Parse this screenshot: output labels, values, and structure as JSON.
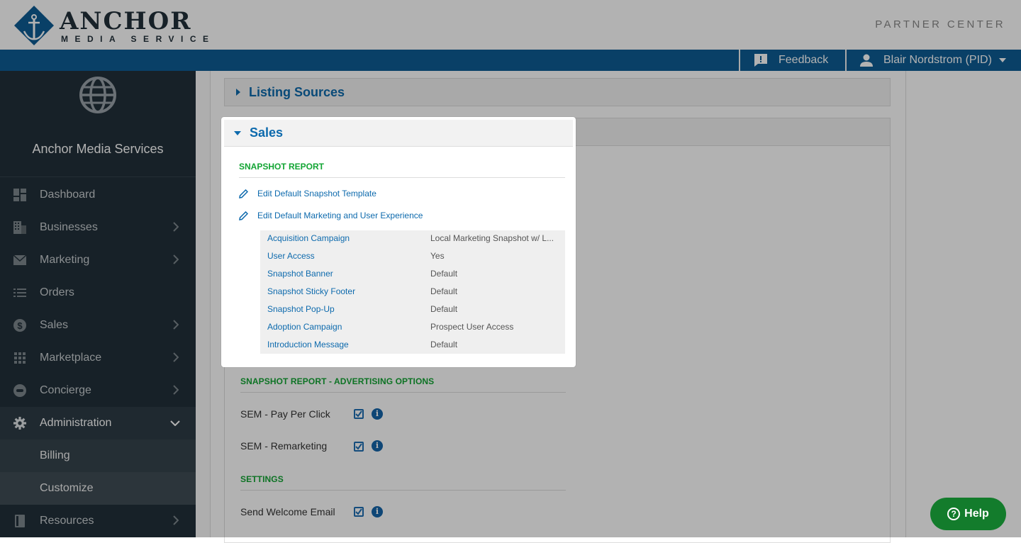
{
  "header": {
    "brand_main": "ANCHOR",
    "brand_sub": "MEDIA SERVICES",
    "partner_center": "PARTNER CENTER"
  },
  "topbar": {
    "feedback": "Feedback",
    "user": "Blair Nordstrom (PID)"
  },
  "sidebar": {
    "brand_name": "Anchor Media Services",
    "items": [
      {
        "label": "Dashboard",
        "icon": "dashboard-icon"
      },
      {
        "label": "Businesses",
        "icon": "building-icon"
      },
      {
        "label": "Marketing",
        "icon": "mail-icon"
      },
      {
        "label": "Orders",
        "icon": "list-icon"
      },
      {
        "label": "Sales",
        "icon": "dollar-icon"
      },
      {
        "label": "Marketplace",
        "icon": "grid-icon"
      },
      {
        "label": "Concierge",
        "icon": "concierge-icon"
      },
      {
        "label": "Administration",
        "icon": "gear-icon"
      },
      {
        "label": "Billing"
      },
      {
        "label": "Customize"
      },
      {
        "label": "Resources",
        "icon": "book-icon"
      }
    ]
  },
  "main": {
    "listing_sources": "Listing Sources",
    "sales": "Sales",
    "advertising_title": "SNAPSHOT REPORT - ADVERTISING OPTIONS",
    "sem_ppc": "SEM - Pay Per Click",
    "sem_remarketing": "SEM - Remarketing",
    "settings_title": "SETTINGS",
    "send_welcome": "Send Welcome Email"
  },
  "spotlight": {
    "title": "Sales",
    "section": "SNAPSHOT REPORT",
    "link1": "Edit Default Snapshot Template",
    "link2": "Edit Default Marketing and User Experience",
    "rows": [
      {
        "key": "Acquisition Campaign",
        "value": "Local Marketing Snapshot w/ L..."
      },
      {
        "key": "User Access",
        "value": "Yes"
      },
      {
        "key": "Snapshot Banner",
        "value": "Default"
      },
      {
        "key": "Snapshot Sticky Footer",
        "value": "Default"
      },
      {
        "key": "Snapshot Pop-Up",
        "value": "Default"
      },
      {
        "key": "Adoption Campaign",
        "value": "Prospect User Access"
      },
      {
        "key": "Introduction Message",
        "value": "Default"
      }
    ]
  },
  "help": {
    "label": "Help"
  },
  "colors": {
    "primary": "#0d5c94",
    "link": "#0d6aad",
    "green": "#13a534",
    "sidebar": "#22303a",
    "help": "#137c2c"
  }
}
